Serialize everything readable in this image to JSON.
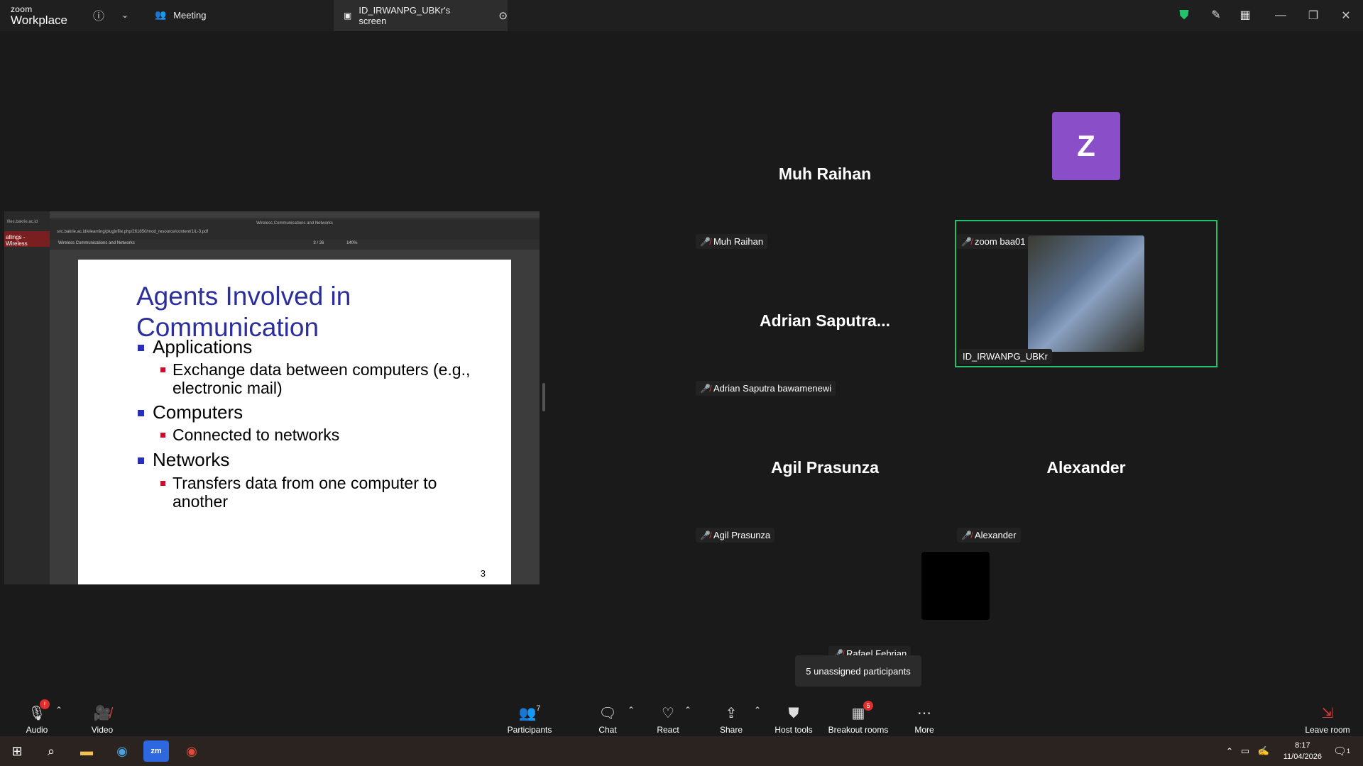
{
  "app": {
    "logo_line1": "zoom",
    "logo_line2": "Workplace"
  },
  "topbar": {
    "meeting_label": "Meeting",
    "share_tab_label": "ID_IRWANPG_UBKr's screen"
  },
  "shared_screen": {
    "site_label": "files.bakrie.ac.id",
    "sidebar_text": "allings - Wireless",
    "browser_tab": "Wireless Communications and Networks",
    "url": "svc.bakrie.ac.id/elearning/pluginfile.php/261850/mod_resource/content/1/L-3.pdf",
    "pdf_title": "Wireless Communications and Networks",
    "page_indicator": "3 / 26",
    "zoom": "140%",
    "slide": {
      "title": "Agents Involved in Communication",
      "items": [
        {
          "label": "Applications",
          "sub": "Exchange data between computers (e.g., electronic mail)"
        },
        {
          "label": "Computers",
          "sub": "Connected to networks"
        },
        {
          "label": "Networks",
          "sub": "Transfers data from one computer to another"
        }
      ],
      "page_number": "3"
    }
  },
  "participants": [
    {
      "display": "Muh Raihan",
      "label": "Muh Raihan"
    },
    {
      "display": "Z",
      "label": "zoom baa01"
    },
    {
      "display": "Adrian Saputra...",
      "label": "Adrian Saputra bawamenewi"
    },
    {
      "display": "",
      "label": "ID_IRWANPG_UBKr"
    },
    {
      "display": "Agil Prasunza",
      "label": "Agil Prasunza"
    },
    {
      "display": "Alexander",
      "label": "Alexander"
    },
    {
      "display": "",
      "label": "Rafael Febrian"
    }
  ],
  "tooltip": "5 unassigned participants",
  "toolbar": {
    "audio": "Audio",
    "video": "Video",
    "participants": "Participants",
    "participants_count": "7",
    "chat": "Chat",
    "react": "React",
    "share": "Share",
    "host_tools": "Host tools",
    "breakout_rooms": "Breakout rooms",
    "breakout_badge": "5",
    "more": "More",
    "leave": "Leave room"
  },
  "taskbar": {
    "time": "8:17",
    "date": "11/04/2026",
    "notif_count": "1"
  },
  "colors": {
    "accent_green": "#23c16b",
    "avatar_purple": "#8a4fc8",
    "mute_red": "#e03b3b",
    "slide_title_blue": "#2b2e9b"
  }
}
